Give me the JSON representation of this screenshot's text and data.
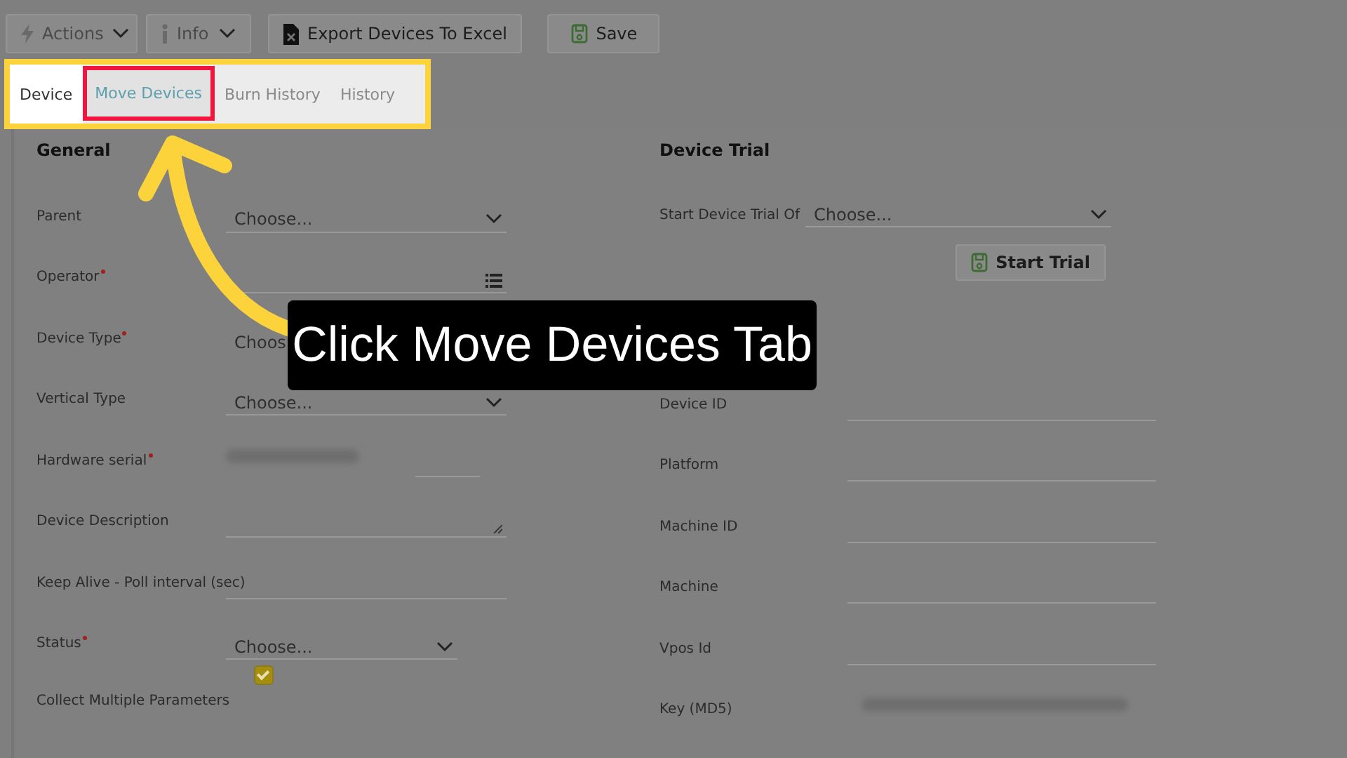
{
  "toolbar": [
    {
      "label": "Actions",
      "disabled": true,
      "caret": true
    },
    {
      "label": "Info",
      "disabled": true,
      "caret": true
    },
    {
      "label": "Export Devices To Excel",
      "disabled": false,
      "caret": false
    },
    {
      "label": "Save",
      "disabled": false,
      "caret": false
    }
  ],
  "tabs": [
    {
      "label": "Device",
      "selected": true,
      "highlighted": false
    },
    {
      "label": "Move Devices",
      "selected": false,
      "highlighted": true
    },
    {
      "label": "Burn History",
      "selected": false,
      "highlighted": false
    },
    {
      "label": "History",
      "selected": false,
      "highlighted": false
    }
  ],
  "general": {
    "title": "General",
    "fields": [
      {
        "label": "Parent",
        "required": false,
        "kind": "select",
        "value": "Choose..."
      },
      {
        "label": "Operator",
        "required": true,
        "kind": "list"
      },
      {
        "label": "Device Type",
        "required": true,
        "kind": "covered",
        "value": "Choos"
      },
      {
        "label": "Vertical Type",
        "required": false,
        "kind": "select",
        "value": "Choose..."
      },
      {
        "label": "Hardware serial",
        "required": true,
        "kind": "redacted"
      },
      {
        "label": "Device Description",
        "required": false,
        "kind": "textarea"
      },
      {
        "label": "Keep Alive - Poll interval (sec)",
        "required": false,
        "kind": "text"
      },
      {
        "label": "Status",
        "required": true,
        "kind": "select_short",
        "value": "Choose..."
      },
      {
        "label": "Collect Multiple Parameters",
        "required": false,
        "kind": "checkbox",
        "checked": true
      }
    ]
  },
  "device_trial": {
    "title": "Device Trial",
    "trial_label": "Start Device Trial Of",
    "trial_value": "Choose...",
    "button": "Start Trial",
    "fields": [
      {
        "label": "Device ID",
        "kind": "text"
      },
      {
        "label": "Platform",
        "kind": "text"
      },
      {
        "label": "Machine ID",
        "kind": "text"
      },
      {
        "label": "Machine",
        "kind": "text"
      },
      {
        "label": "Vpos Id",
        "kind": "text"
      },
      {
        "label": "Key (MD5)",
        "kind": "redacted"
      }
    ]
  },
  "callout": {
    "text": "Click Move Devices Tab"
  }
}
